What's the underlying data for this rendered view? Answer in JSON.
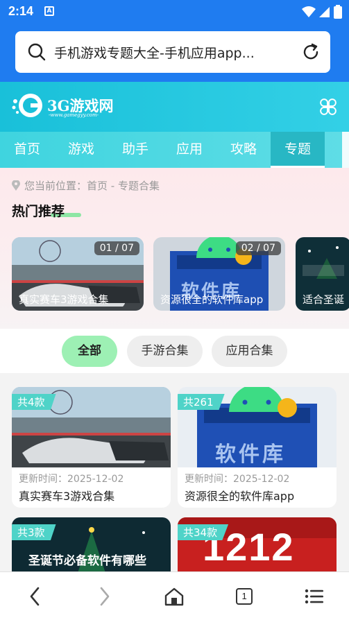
{
  "status_bar": {
    "time": "2:14",
    "notification_glyph": "A"
  },
  "address_bar": {
    "url_text": "手机游戏专题大全-手机应用app..."
  },
  "site": {
    "brand": "3G游戏网",
    "domain": "-www.gamegyy.com-",
    "accent_color": "#19c0d9"
  },
  "nav": {
    "items": [
      {
        "label": "首页"
      },
      {
        "label": "游戏"
      },
      {
        "label": "助手"
      },
      {
        "label": "应用"
      },
      {
        "label": "攻略"
      },
      {
        "label": "专题"
      }
    ],
    "active": "专题"
  },
  "breadcrumb": {
    "text": "您当前位置：首页 - 专题合集"
  },
  "hot": {
    "title": "热门推荐",
    "slides": [
      {
        "counter": "01 / 07",
        "caption": "真实赛车3游戏合集"
      },
      {
        "counter": "02 / 07",
        "caption": "资源很全的软件库app"
      },
      {
        "counter": "",
        "caption": "适合圣诞"
      }
    ]
  },
  "filters": [
    {
      "label": "全部",
      "active": true
    },
    {
      "label": "手游合集",
      "active": false
    },
    {
      "label": "应用合集",
      "active": false
    }
  ],
  "collections": [
    {
      "badge": "共4款",
      "date": "更新时间：2025-12-02",
      "title": "真实赛车3游戏合集",
      "image": "racing"
    },
    {
      "badge": "共261",
      "date": "更新时间：2025-12-02",
      "title": "资源很全的软件库app",
      "image": "software-library"
    },
    {
      "badge": "共3款",
      "date": "",
      "title": "",
      "image": "christmas",
      "banner_text": "圣诞节必备软件有哪些"
    },
    {
      "badge": "共34款",
      "date": "",
      "title": "",
      "image": "1212-sale",
      "banner_text": "1212"
    }
  ],
  "software_library_text": "软件库",
  "bottom_bar": {
    "tab_count": "1"
  }
}
